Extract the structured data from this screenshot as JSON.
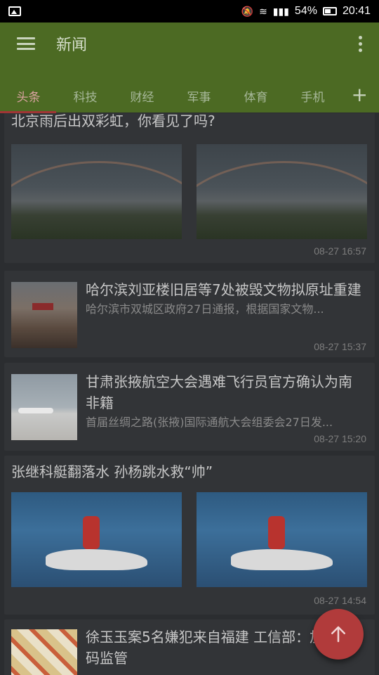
{
  "status_bar": {
    "battery_percent": "54%",
    "time": "20:41"
  },
  "app_title": "新闻",
  "tabs": [
    {
      "label": "头条",
      "active": true
    },
    {
      "label": "科技"
    },
    {
      "label": "财经"
    },
    {
      "label": "军事"
    },
    {
      "label": "体育"
    },
    {
      "label": "手机"
    }
  ],
  "tab_add_icon": "plus-icon",
  "feed": [
    {
      "type": "double-image",
      "title": "北京雨后出双彩虹，你看见了吗?",
      "time": "08-27 16:57"
    },
    {
      "type": "single-image",
      "title": "哈尔滨刘亚楼旧居等7处被毁文物拟原址重建",
      "summary": "哈尔滨市双城区政府27日通报，根据国家文物...",
      "time": "08-27 15:37"
    },
    {
      "type": "single-image",
      "title": "甘肃张掖航空大会遇难飞行员官方确认为南非籍",
      "summary": "首届丝绸之路(张掖)国际通航大会组委会27日发...",
      "time": "08-27 15:20"
    },
    {
      "type": "double-image",
      "title": "张继科艇翻落水 孙杨跳水救“帅”",
      "time": "08-27 14:54"
    },
    {
      "type": "single-image",
      "title": "徐玉玉案5名嫌犯来自福建 工信部：加大号码监管",
      "summary": "",
      "time": ""
    }
  ],
  "fab_icon": "arrow-up-icon",
  "colors": {
    "toolbar": "#4c6a23",
    "background": "#2b2d30",
    "fab": "#b13b3b",
    "tab_indicator": "#a03535"
  }
}
